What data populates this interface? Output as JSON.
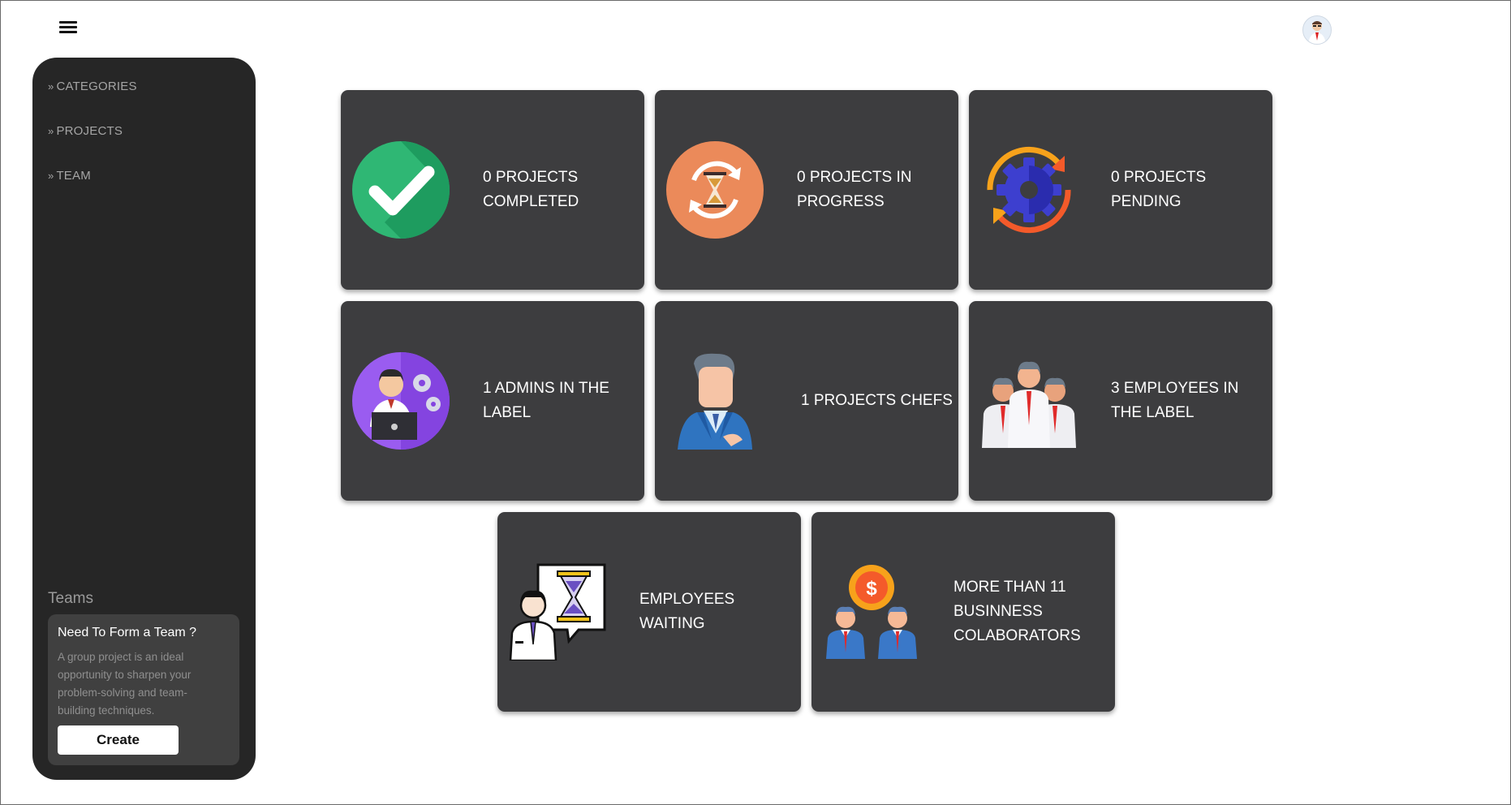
{
  "header": {
    "menu_icon": "hamburger-menu-icon",
    "avatar_icon": "user-avatar"
  },
  "sidebar": {
    "items": [
      {
        "label": "CATEGORIES",
        "icon": "double-chevron-right-icon"
      },
      {
        "label": "PROJECTS",
        "icon": "double-chevron-right-icon"
      },
      {
        "label": "TEAM",
        "icon": "double-chevron-right-icon"
      }
    ],
    "teams_title": "Teams",
    "team_card": {
      "title": "Need To Form a Team ?",
      "description": "A group project is an ideal opportunity to sharpen your problem-solving and team-building techniques.",
      "button_label": "Create"
    }
  },
  "cards": [
    {
      "label": "0 PROJECTS COMPLETED",
      "icon": "check-circle-icon"
    },
    {
      "label": "0 PROJECTS IN PROGRESS",
      "icon": "hourglass-refresh-icon"
    },
    {
      "label": "0 PROJECTS PENDING",
      "icon": "gear-refresh-icon"
    },
    {
      "label": "1 ADMINS IN THE LABEL",
      "icon": "admin-laptop-icon"
    },
    {
      "label": "1 PROJECTS CHEFS",
      "icon": "manager-icon"
    },
    {
      "label": "3 EMPLOYEES IN THE LABEL",
      "icon": "employees-group-icon"
    },
    {
      "label": "EMPLOYEES WAITING",
      "icon": "employee-waiting-icon"
    },
    {
      "label": "MORE THAN 11 BUSINNESS COLABORATORS",
      "icon": "business-collaborators-icon"
    }
  ],
  "colors": {
    "card_bg": "#3d3d3f",
    "sidebar_bg": "#262626",
    "accent_green": "#2fb774",
    "accent_orange": "#eb8a5a"
  }
}
